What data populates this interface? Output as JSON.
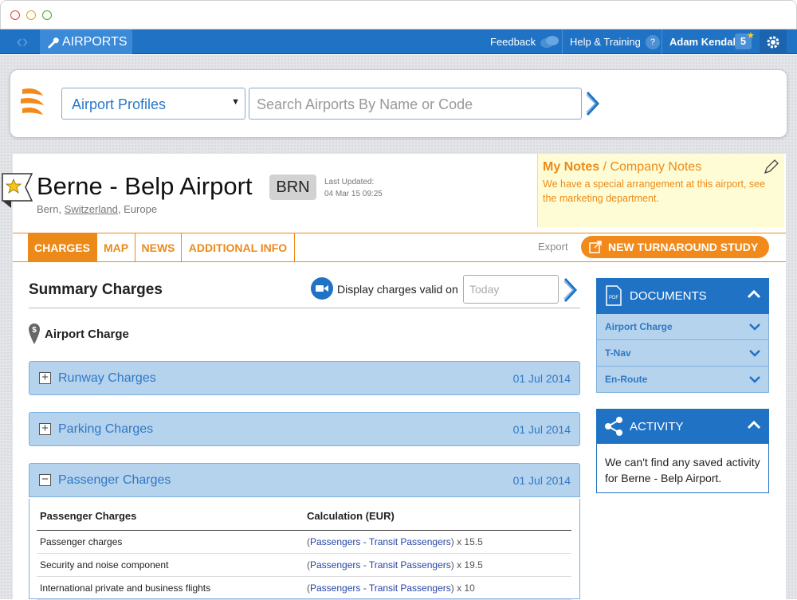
{
  "topbar": {
    "app_name": "AIRPORTS",
    "feedback": "Feedback",
    "help": "Help & Training",
    "user": "Adam Kendall",
    "badge_count": "5"
  },
  "search": {
    "profile_select": "Airport Profiles",
    "placeholder": "Search Airports By Name or Code"
  },
  "airport": {
    "name": "Berne - Belp Airport",
    "code": "BRN",
    "last_updated_label": "Last Updated:",
    "last_updated": "04 Mar 15 09:25",
    "city": "Bern,",
    "country": "Switzerland",
    "region": ", Europe"
  },
  "notes": {
    "my_notes": "My Notes",
    "separator": " / ",
    "company_notes": "Company Notes",
    "text": "We have a special arrangement at this airport, see the marketing department."
  },
  "tabs": [
    "CHARGES",
    "MAP",
    "NEWS",
    "ADDITIONAL INFO"
  ],
  "actions": {
    "export": "Export",
    "new_study": "NEW TURNAROUND STUDY"
  },
  "summary": {
    "title": "Summary Charges",
    "display_label": "Display charges valid on",
    "date_placeholder": "Today",
    "section": "Airport Charge"
  },
  "accordions": [
    {
      "label": "Runway Charges",
      "date": "01 Jul 2014",
      "icon": "+"
    },
    {
      "label": "Parking Charges",
      "date": "01 Jul 2014",
      "icon": "+"
    },
    {
      "label": "Passenger Charges",
      "date": "01 Jul 2014",
      "icon": "−"
    }
  ],
  "passenger_table": {
    "headers": [
      "Passenger Charges",
      "Calculation (EUR)"
    ],
    "rows": [
      {
        "name": "Passenger charges",
        "open": "(",
        "link": "Passengers - Transit Passengers",
        "rest": ") x 15.5"
      },
      {
        "name": "Security and noise component",
        "open": "(",
        "link": "Passengers - Transit Passengers",
        "rest": ") x 19.5"
      },
      {
        "name": "International private and business flights",
        "open": "(",
        "link": "Passengers - Transit Passengers",
        "rest": ") x 10"
      }
    ]
  },
  "documents": {
    "title": "DOCUMENTS",
    "items": [
      "Airport Charge",
      "T-Nav",
      "En-Route"
    ]
  },
  "activity": {
    "title": "ACTIVITY",
    "text": "We can't find any saved activity for Berne - Belp Airport."
  },
  "colors": {
    "brand_blue": "#2072c4",
    "accent_orange": "#ec8a19",
    "accordion_bg": "#b6d3ee"
  }
}
